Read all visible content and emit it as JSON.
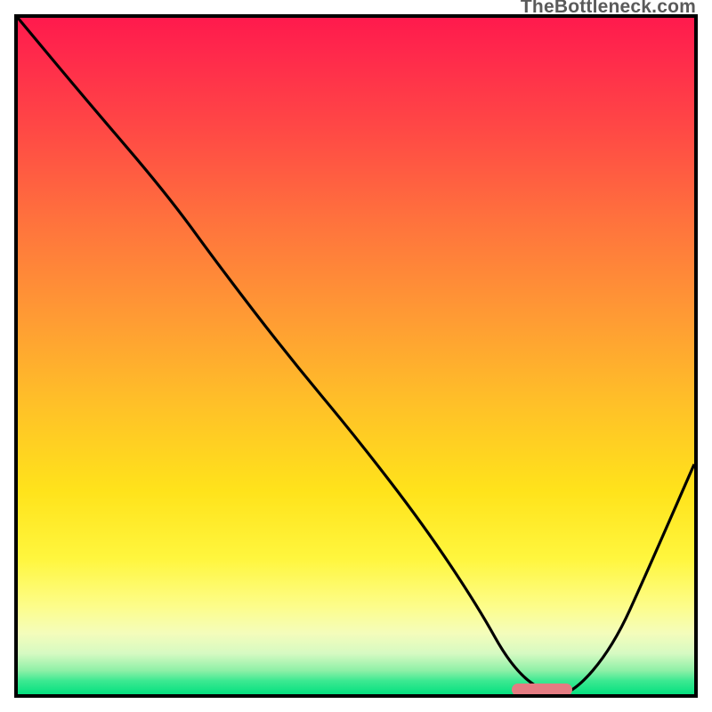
{
  "watermark": "TheBottleneck.com",
  "chart_data": {
    "type": "line",
    "title": "",
    "xlabel": "",
    "ylabel": "",
    "xlim": [
      0,
      100
    ],
    "ylim": [
      0,
      100
    ],
    "grid": false,
    "legend": false,
    "gradient_colors_top_to_bottom": [
      "#ff1a4d",
      "#ff723d",
      "#ffe31b",
      "#fdfd8a",
      "#05e07f"
    ],
    "series": [
      {
        "name": "curve",
        "color": "#000000",
        "x": [
          0,
          10,
          22,
          30,
          40,
          50,
          60,
          68,
          73,
          78,
          82,
          88,
          93,
          100
        ],
        "y": [
          100,
          88,
          74,
          63,
          50,
          38,
          25,
          13,
          4,
          0,
          0,
          7,
          18,
          34
        ]
      }
    ],
    "marker": {
      "color": "#e47c82",
      "x_start": 73,
      "x_end": 82,
      "y": 0.6
    }
  }
}
